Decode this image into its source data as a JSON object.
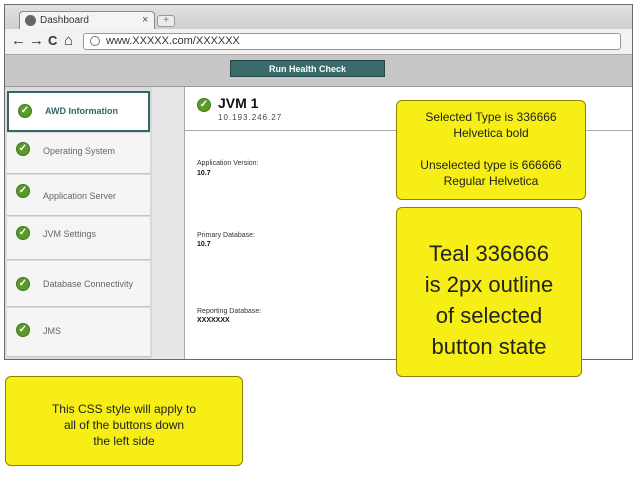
{
  "browser": {
    "tab_title": "Dashboard",
    "tab_close": "×",
    "new_tab": "+",
    "nav": {
      "back": "←",
      "forward": "→",
      "reload": "C",
      "home": "⌂"
    },
    "url": "www.XXXXX.com/XXXXXX"
  },
  "toolbar": {
    "run_label": "Run Health Check"
  },
  "sidebar": {
    "items": [
      {
        "label": "AWD Information",
        "selected": true
      },
      {
        "label": "Operating System",
        "selected": false
      },
      {
        "label": "Application Server",
        "selected": false
      },
      {
        "label": "JVM Settings",
        "selected": false
      },
      {
        "label": "Database Connectivity",
        "selected": false
      },
      {
        "label": "JMS",
        "selected": false
      }
    ],
    "check_glyph": "✓"
  },
  "main": {
    "title": "JVM 1",
    "ip": "10.193.246.27",
    "fields": [
      {
        "label": "Application Version:",
        "value": "10.7"
      },
      {
        "label": "Primary Database:",
        "value": "10.7"
      },
      {
        "label": "Reporting Database:",
        "value": "XXXXXXX"
      }
    ]
  },
  "notes": {
    "type_note": [
      "Selected Type is 336666",
      "Helvetica bold",
      "",
      "Unselected type is 666666",
      "Regular Helvetica"
    ],
    "teal_note": [
      "Teal 336666",
      "is 2px outline",
      "of selected",
      "button state"
    ],
    "css_note": [
      "This CSS style will apply to",
      "all of the buttons down",
      "the left side"
    ]
  },
  "colors": {
    "teal": "#336666",
    "unselected_text": "#666666",
    "note_yellow": "#f6ee14",
    "check_green": "#5a9a2a"
  }
}
